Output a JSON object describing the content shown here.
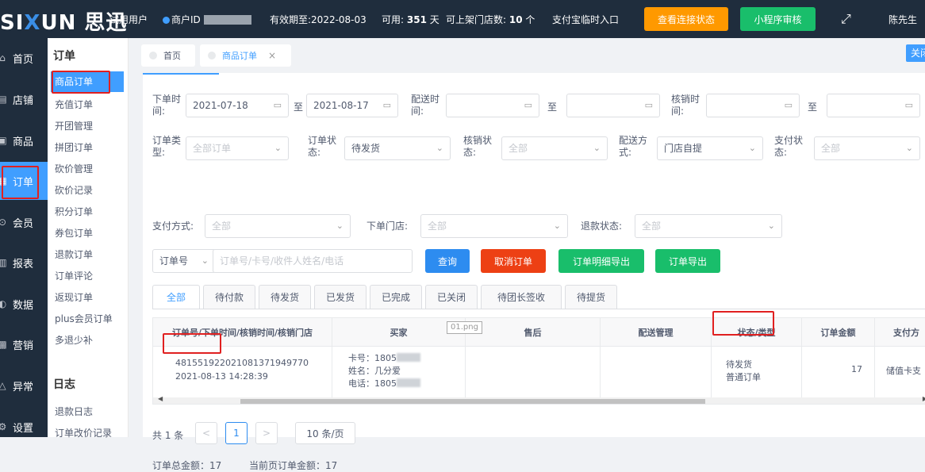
{
  "topbar": {
    "logo_text_a": "SI",
    "logo_text_x": "X",
    "logo_text_b": "UN 思迅",
    "user_type": "试用用户",
    "merchant_id_label": "商户ID",
    "expiry": "有效期至:2022-08-03",
    "available_prefix": "可用:",
    "available_days": "351",
    "available_suffix": "天",
    "stores_prefix": "可上架门店数:",
    "stores_count": "10",
    "stores_suffix": "个",
    "alipay_entry": "支付宝临时入口",
    "check_connection_btn": "查看连接状态",
    "miniprogram_review_btn": "小程序审核",
    "expand_icon": "⤢",
    "username": "陈先生"
  },
  "sidebar_main": [
    {
      "icon": "⌂",
      "label": "首页"
    },
    {
      "icon": "▤",
      "label": "店铺"
    },
    {
      "icon": "▣",
      "label": "商品"
    },
    {
      "icon": "▦",
      "label": "订单"
    },
    {
      "icon": "⊙",
      "label": "会员"
    },
    {
      "icon": "▥",
      "label": "报表"
    },
    {
      "icon": "◐",
      "label": "数据"
    },
    {
      "icon": "▩",
      "label": "营销"
    },
    {
      "icon": "△",
      "label": "异常"
    },
    {
      "icon": "⚙",
      "label": "设置"
    }
  ],
  "sidebar_sub": {
    "group1_title": "订单",
    "items": [
      "商品订单",
      "充值订单",
      "开团管理",
      "拼团订单",
      "砍价管理",
      "砍价记录",
      "积分订单",
      "券包订单",
      "退款订单",
      "订单评论",
      "返现订单",
      "plus会员订单",
      "多退少补"
    ],
    "group2_title": "日志",
    "group2_items": [
      "退款日志",
      "订单改价记录"
    ]
  },
  "tabs": {
    "home": "首页",
    "current": "商品订单",
    "close_icon": "×",
    "close_btn": "关闭"
  },
  "filters": {
    "order_time_label": "下单时间:",
    "order_time_from": "2021-07-18",
    "order_time_to": "2021-08-17",
    "delivery_time_label": "配送时间:",
    "verify_time_label": "核销时间:",
    "to": "至",
    "order_type_label": "订单类型:",
    "order_type_value": "全部订单",
    "order_status_label": "订单状态:",
    "order_status_value": "待发货",
    "verify_status_label": "核销状态:",
    "verify_status_value": "全部",
    "delivery_method_label": "配送方式:",
    "delivery_method_value": "门店自提",
    "pay_status_label": "支付状态:",
    "pay_status_value": "全部",
    "pay_method_label": "支付方式:",
    "pay_method_value": "全部",
    "store_label": "下单门店:",
    "store_value": "全部",
    "refund_status_label": "退款状态:",
    "refund_status_value": "全部",
    "search_field": "订单号",
    "search_placeholder": "订单号/卡号/收件人姓名/电话"
  },
  "actions": {
    "query": "查询",
    "cancel_order": "取消订单",
    "export_detail": "订单明细导出",
    "export": "订单导出"
  },
  "status_tabs": [
    "全部",
    "待付款",
    "待发货",
    "已发货",
    "已完成",
    "已关闭",
    "待团长签收",
    "待提货"
  ],
  "table": {
    "headers": [
      "订单号/下单时间/核销时间/核销门店",
      "买家",
      "售后",
      "配送管理",
      "状态/类型",
      "订单金额",
      "支付方"
    ],
    "rows": [
      {
        "order_no": "481551922021081371949770",
        "order_time": "2021-08-13 14:28:39",
        "card": "卡号：1805",
        "name": "姓名：几分爱",
        "phone": "电话：1805",
        "status": "待发货",
        "type": "普通订单",
        "amount": "17",
        "pay": "储值卡支"
      }
    ],
    "tooltip": "01.png"
  },
  "pagination": {
    "total": "共 1 条",
    "prev": "<",
    "page": "1",
    "next": ">",
    "page_size": "10 条/页"
  },
  "summary": {
    "total_amount": "订单总金额：17",
    "page_amount": "当前页订单金额：17"
  }
}
